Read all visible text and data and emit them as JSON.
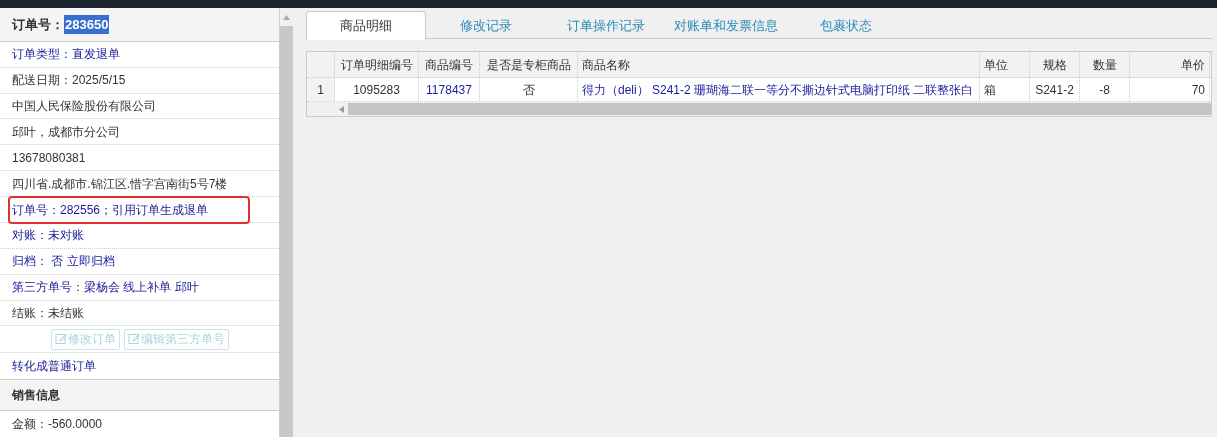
{
  "order_header": {
    "label": "订单号：",
    "value": "283650",
    "selected": true
  },
  "info_rows": [
    {
      "kind": "link",
      "text": "订单类型：直发退单",
      "highlighted": false
    },
    {
      "kind": "text",
      "text": "配送日期：2025/5/15",
      "highlighted": false
    },
    {
      "kind": "text",
      "text": "中国人民保险股份有限公司",
      "highlighted": false
    },
    {
      "kind": "text",
      "text": "邱叶，成都市分公司",
      "highlighted": false
    },
    {
      "kind": "text",
      "text": "13678080381",
      "highlighted": false
    },
    {
      "kind": "text",
      "text": "四川省.成都市.锦江区.惜字宫南街5号7楼",
      "highlighted": false
    },
    {
      "kind": "link",
      "text": "订单号：282556；引用订单生成退单",
      "highlighted": true
    },
    {
      "kind": "link",
      "text": "对账：未对账",
      "highlighted": false
    },
    {
      "kind": "link",
      "text": "归档： 否 立即归档",
      "highlighted": false
    },
    {
      "kind": "link",
      "text": "第三方单号：梁杨会 线上补单 邱叶",
      "highlighted": false
    },
    {
      "kind": "text",
      "text": "结账：未结账",
      "highlighted": false
    }
  ],
  "action_buttons": [
    {
      "label": "修改订单",
      "disabled": true
    },
    {
      "label": "编辑第三方单号",
      "disabled": true
    }
  ],
  "convert_link": "转化成普通订单",
  "sales_section": {
    "title": "销售信息",
    "amount": "金额：-560.0000"
  },
  "tabs": [
    {
      "label": "商品明细",
      "selected": true
    },
    {
      "label": "修改记录",
      "selected": false
    },
    {
      "label": "订单操作记录",
      "selected": false
    },
    {
      "label": "对账单和发票信息",
      "selected": false
    },
    {
      "label": "包裹状态",
      "selected": false
    }
  ],
  "table": {
    "columns": [
      "订单明细编号",
      "商品编号",
      "是否是专柜商品",
      "商品名称",
      "单位",
      "规格",
      "数量",
      "单价"
    ],
    "rows": [
      {
        "index": "1",
        "cells": [
          "1095283",
          "1178437",
          "否",
          "得力（deli） S241-2 珊瑚海二联一等分不撕边针式电脑打印纸 二联整张白",
          "箱",
          "S241-2",
          "-8",
          "70"
        ]
      }
    ]
  }
}
